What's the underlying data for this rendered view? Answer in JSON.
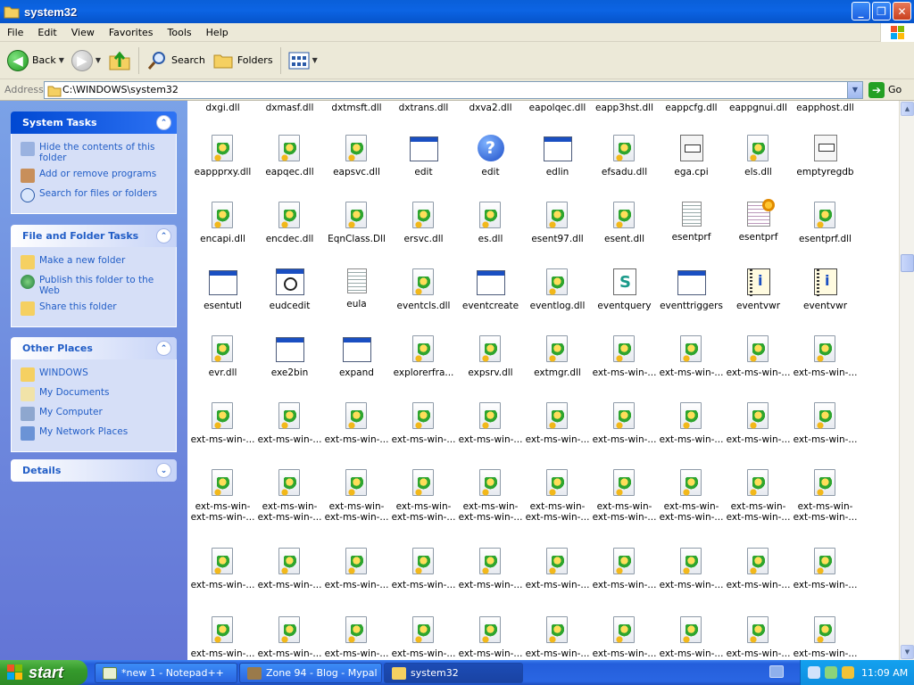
{
  "window": {
    "title": "system32"
  },
  "menu": [
    "File",
    "Edit",
    "View",
    "Favorites",
    "Tools",
    "Help"
  ],
  "toolbar": {
    "back": "Back",
    "search": "Search",
    "folders": "Folders"
  },
  "address": {
    "label": "Address",
    "value": "C:\\WINDOWS\\system32",
    "go": "Go"
  },
  "tasks": {
    "system": {
      "title": "System Tasks",
      "items": [
        "Hide the contents of this folder",
        "Add or remove programs",
        "Search for files or folders"
      ]
    },
    "file_folder": {
      "title": "File and Folder Tasks",
      "items": [
        "Make a new folder",
        "Publish this folder to the Web",
        "Share this folder"
      ]
    },
    "other_places": {
      "title": "Other Places",
      "items": [
        "WINDOWS",
        "My Documents",
        "My Computer",
        "My Network Places"
      ]
    },
    "details": {
      "title": "Details"
    }
  },
  "files": {
    "top_row": [
      "dxgi.dll",
      "dxmasf.dll",
      "dxtmsft.dll",
      "dxtrans.dll",
      "dxva2.dll",
      "eapolqec.dll",
      "eapp3hst.dll",
      "eappcfg.dll",
      "eappgnui.dll",
      "eapphost.dll"
    ],
    "rows": [
      [
        {
          "name": "eappprxy.dll",
          "icon": "dll"
        },
        {
          "name": "eapqec.dll",
          "icon": "dll"
        },
        {
          "name": "eapsvc.dll",
          "icon": "dll"
        },
        {
          "name": "edit",
          "icon": "app"
        },
        {
          "name": "edit",
          "icon": "help"
        },
        {
          "name": "edlin",
          "icon": "app"
        },
        {
          "name": "efsadu.dll",
          "icon": "dll"
        },
        {
          "name": "ega.cpi",
          "icon": "cpi"
        },
        {
          "name": "els.dll",
          "icon": "dll"
        },
        {
          "name": "emptyregdb",
          "icon": "blank"
        }
      ],
      [
        {
          "name": "encapi.dll",
          "icon": "dll"
        },
        {
          "name": "encdec.dll",
          "icon": "dll"
        },
        {
          "name": "EqnClass.Dll",
          "icon": "dll"
        },
        {
          "name": "ersvc.dll",
          "icon": "dll"
        },
        {
          "name": "es.dll",
          "icon": "dll"
        },
        {
          "name": "esent97.dll",
          "icon": "dll"
        },
        {
          "name": "esent.dll",
          "icon": "dll"
        },
        {
          "name": "esentprf",
          "icon": "txt"
        },
        {
          "name": "esentprf",
          "icon": "cfg"
        },
        {
          "name": "esentprf.dll",
          "icon": "dll"
        }
      ],
      [
        {
          "name": "esentutl",
          "icon": "app"
        },
        {
          "name": "eudcedit",
          "icon": "mag"
        },
        {
          "name": "eula",
          "icon": "txt"
        },
        {
          "name": "eventcls.dll",
          "icon": "dll"
        },
        {
          "name": "eventcreate",
          "icon": "app"
        },
        {
          "name": "eventlog.dll",
          "icon": "dll"
        },
        {
          "name": "eventquery",
          "icon": "query"
        },
        {
          "name": "eventtriggers",
          "icon": "app"
        },
        {
          "name": "eventvwr",
          "icon": "book"
        },
        {
          "name": "eventvwr",
          "icon": "book"
        }
      ],
      [
        {
          "name": "evr.dll",
          "icon": "dll"
        },
        {
          "name": "exe2bin",
          "icon": "app"
        },
        {
          "name": "expand",
          "icon": "app"
        },
        {
          "name": "explorerfra...",
          "icon": "dll"
        },
        {
          "name": "expsrv.dll",
          "icon": "dll"
        },
        {
          "name": "extmgr.dll",
          "icon": "dll"
        },
        {
          "name": "ext-ms-win-...",
          "icon": "dll"
        },
        {
          "name": "ext-ms-win-...",
          "icon": "dll"
        },
        {
          "name": "ext-ms-win-...",
          "icon": "dll"
        },
        {
          "name": "ext-ms-win-...",
          "icon": "dll"
        }
      ],
      [
        {
          "name": "ext-ms-win-...",
          "icon": "dll"
        },
        {
          "name": "ext-ms-win-...",
          "icon": "dll"
        },
        {
          "name": "ext-ms-win-...",
          "icon": "dll"
        },
        {
          "name": "ext-ms-win-...",
          "icon": "dll"
        },
        {
          "name": "ext-ms-win-...",
          "icon": "dll"
        },
        {
          "name": "ext-ms-win-...",
          "icon": "dll"
        },
        {
          "name": "ext-ms-win-...",
          "icon": "dll"
        },
        {
          "name": "ext-ms-win-...",
          "icon": "dll"
        },
        {
          "name": "ext-ms-win-...",
          "icon": "dll"
        },
        {
          "name": "ext-ms-win-...",
          "icon": "dll"
        }
      ],
      [
        {
          "name": "ext-ms-win-\next-ms-win-...",
          "icon": "dll"
        },
        {
          "name": "ext-ms-win-\next-ms-win-...",
          "icon": "dll"
        },
        {
          "name": "ext-ms-win-\next-ms-win-...",
          "icon": "dll"
        },
        {
          "name": "ext-ms-win-\next-ms-win-...",
          "icon": "dll"
        },
        {
          "name": "ext-ms-win-\next-ms-win-...",
          "icon": "dll"
        },
        {
          "name": "ext-ms-win-\next-ms-win-...",
          "icon": "dll"
        },
        {
          "name": "ext-ms-win-\next-ms-win-...",
          "icon": "dll"
        },
        {
          "name": "ext-ms-win-\next-ms-win-...",
          "icon": "dll"
        },
        {
          "name": "ext-ms-win-\next-ms-win-...",
          "icon": "dll"
        },
        {
          "name": "ext-ms-win-\next-ms-win-...",
          "icon": "dll"
        }
      ],
      [
        {
          "name": "ext-ms-win-...",
          "icon": "dll"
        },
        {
          "name": "ext-ms-win-...",
          "icon": "dll"
        },
        {
          "name": "ext-ms-win-...",
          "icon": "dll"
        },
        {
          "name": "ext-ms-win-...",
          "icon": "dll"
        },
        {
          "name": "ext-ms-win-...",
          "icon": "dll"
        },
        {
          "name": "ext-ms-win-...",
          "icon": "dll"
        },
        {
          "name": "ext-ms-win-...",
          "icon": "dll"
        },
        {
          "name": "ext-ms-win-...",
          "icon": "dll"
        },
        {
          "name": "ext-ms-win-...",
          "icon": "dll"
        },
        {
          "name": "ext-ms-win-...",
          "icon": "dll"
        }
      ],
      [
        {
          "name": "ext-ms-win-...",
          "icon": "dll"
        },
        {
          "name": "ext-ms-win-...",
          "icon": "dll"
        },
        {
          "name": "ext-ms-win-...",
          "icon": "dll"
        },
        {
          "name": "ext-ms-win-...",
          "icon": "dll"
        },
        {
          "name": "ext-ms-win-...",
          "icon": "dll"
        },
        {
          "name": "ext-ms-win-...",
          "icon": "dll"
        },
        {
          "name": "ext-ms-win-...",
          "icon": "dll"
        },
        {
          "name": "ext-ms-win-...",
          "icon": "dll"
        },
        {
          "name": "ext-ms-win-...",
          "icon": "dll"
        },
        {
          "name": "ext-ms-win-...",
          "icon": "dll"
        }
      ]
    ]
  },
  "taskbar": {
    "start": "start",
    "buttons": [
      "*new 1 - Notepad++",
      "Zone 94 - Blog - Mypal",
      "system32"
    ],
    "clock": "11:09 AM"
  },
  "colors": {
    "titlebar": "#0c64e4",
    "taskpane": "#6f8fe0",
    "link": "#215dc6",
    "start": "#359a2c"
  }
}
